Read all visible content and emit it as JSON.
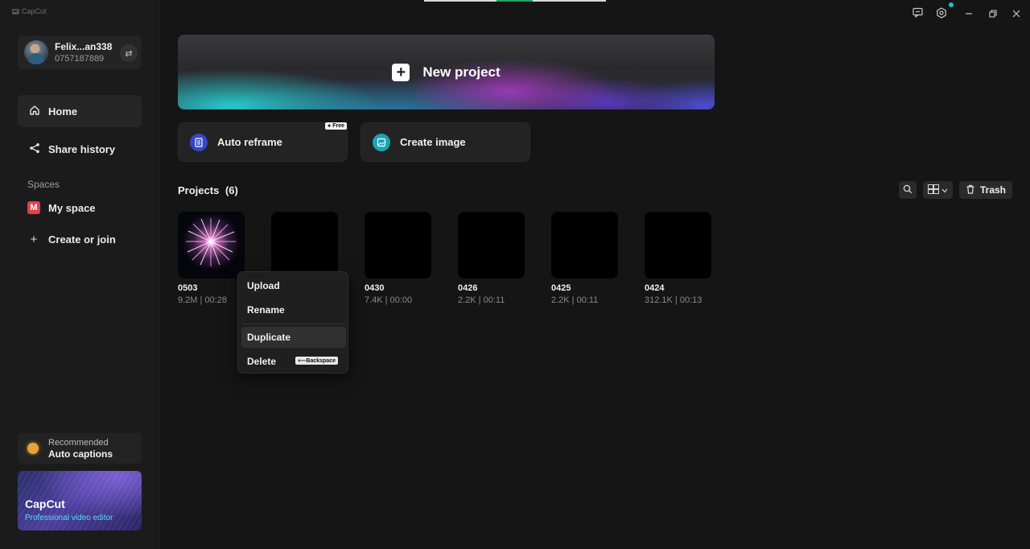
{
  "app": {
    "logo_text": "CapCut"
  },
  "user": {
    "name": "Felix...an338",
    "id": "0757187889"
  },
  "sidebar": {
    "home": "Home",
    "share_history": "Share history",
    "spaces_label": "Spaces",
    "my_space": "My space",
    "my_space_badge": "M",
    "create_or_join": "Create or join",
    "recommended_label": "Recommended",
    "recommended_item": "Auto captions",
    "promo_title": "CapCut",
    "promo_subtitle": "Professional video editor"
  },
  "main": {
    "new_project": "New project",
    "auto_reframe": "Auto reframe",
    "free_tag": "Free",
    "create_image": "Create image",
    "projects_label": "Projects",
    "projects_count": "(6)",
    "trash": "Trash"
  },
  "projects": [
    {
      "name": "0503",
      "meta": "9.2M | 00:28"
    },
    {
      "name": "",
      "meta": ""
    },
    {
      "name": "0430",
      "meta": "7.4K | 00:00"
    },
    {
      "name": "0426",
      "meta": "2.2K | 00:11"
    },
    {
      "name": "0425",
      "meta": "2.2K | 00:11"
    },
    {
      "name": "0424",
      "meta": "312.1K | 00:13"
    }
  ],
  "context_menu": {
    "upload": "Upload",
    "rename": "Rename",
    "duplicate": "Duplicate",
    "delete": "Delete",
    "delete_shortcut": "⟵Backspace"
  },
  "colors": {
    "accent_teal": "#1fc0d2",
    "badge_red": "#e0414b",
    "reframe_blue": "#3546c9"
  }
}
